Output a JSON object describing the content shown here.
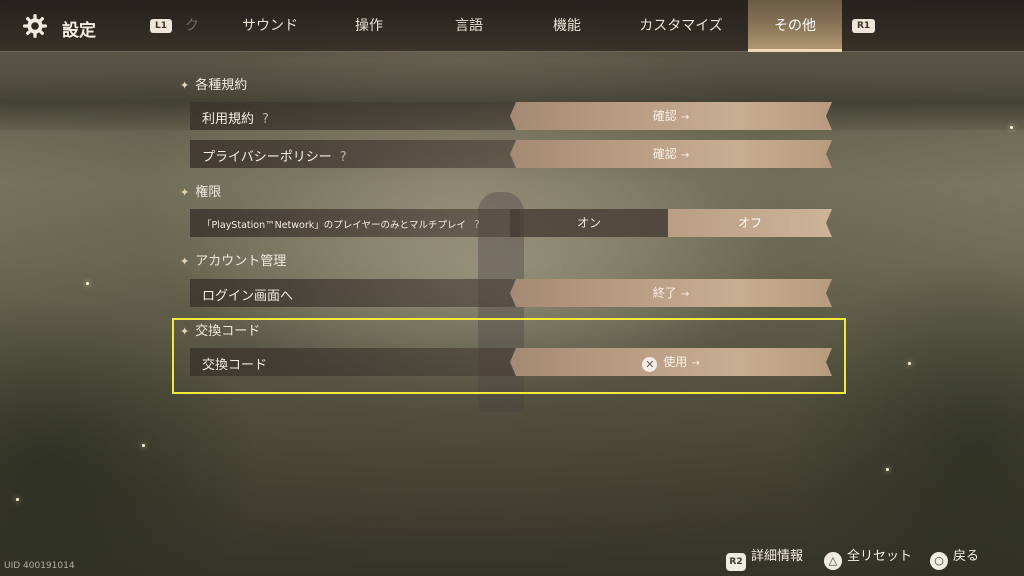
{
  "header": {
    "title": "設定",
    "left_bumper": "L1",
    "right_bumper": "R1",
    "tabs": [
      {
        "label": "ク",
        "state": "faded"
      },
      {
        "label": "サウンド",
        "state": "normal"
      },
      {
        "label": "操作",
        "state": "normal"
      },
      {
        "label": "言語",
        "state": "normal"
      },
      {
        "label": "機能",
        "state": "normal"
      },
      {
        "label": "カスタマイズ",
        "state": "normal"
      },
      {
        "label": "その他",
        "state": "active"
      }
    ]
  },
  "sections": [
    {
      "title": "各種規約",
      "rows": [
        {
          "label": "利用規約",
          "help": "?",
          "action": "確認"
        },
        {
          "label": "プライバシーポリシー",
          "help": "?",
          "action": "確認"
        }
      ]
    },
    {
      "title": "権限",
      "rows": [
        {
          "label": "「PlayStation™Network」のプレイヤーのみとマルチプレイ",
          "help": "?",
          "toggle_on": "オン",
          "toggle_off": "オフ",
          "selected": "オフ"
        }
      ]
    },
    {
      "title": "アカウント管理",
      "rows": [
        {
          "label": "ログイン画面へ",
          "action": "終了"
        }
      ]
    },
    {
      "title": "交換コード",
      "rows": [
        {
          "label": "交換コード",
          "action": "使用",
          "button_glyph": "✕"
        }
      ]
    }
  ],
  "footer": {
    "uid": "UID 400191014",
    "details_key": "R2",
    "details_label": "詳細情報",
    "reset_label": "全リセット",
    "back_label": "戻る"
  },
  "colors": {
    "highlight_box": "#f1e93a",
    "button_fill": "#b69a80",
    "active_tab": "#8a7558"
  },
  "icons": {
    "settings": "gear-icon",
    "arrow": "arrow-right-icon",
    "cross": "cross-button-icon",
    "triangle": "triangle-button-icon",
    "circle": "circle-button-icon"
  }
}
